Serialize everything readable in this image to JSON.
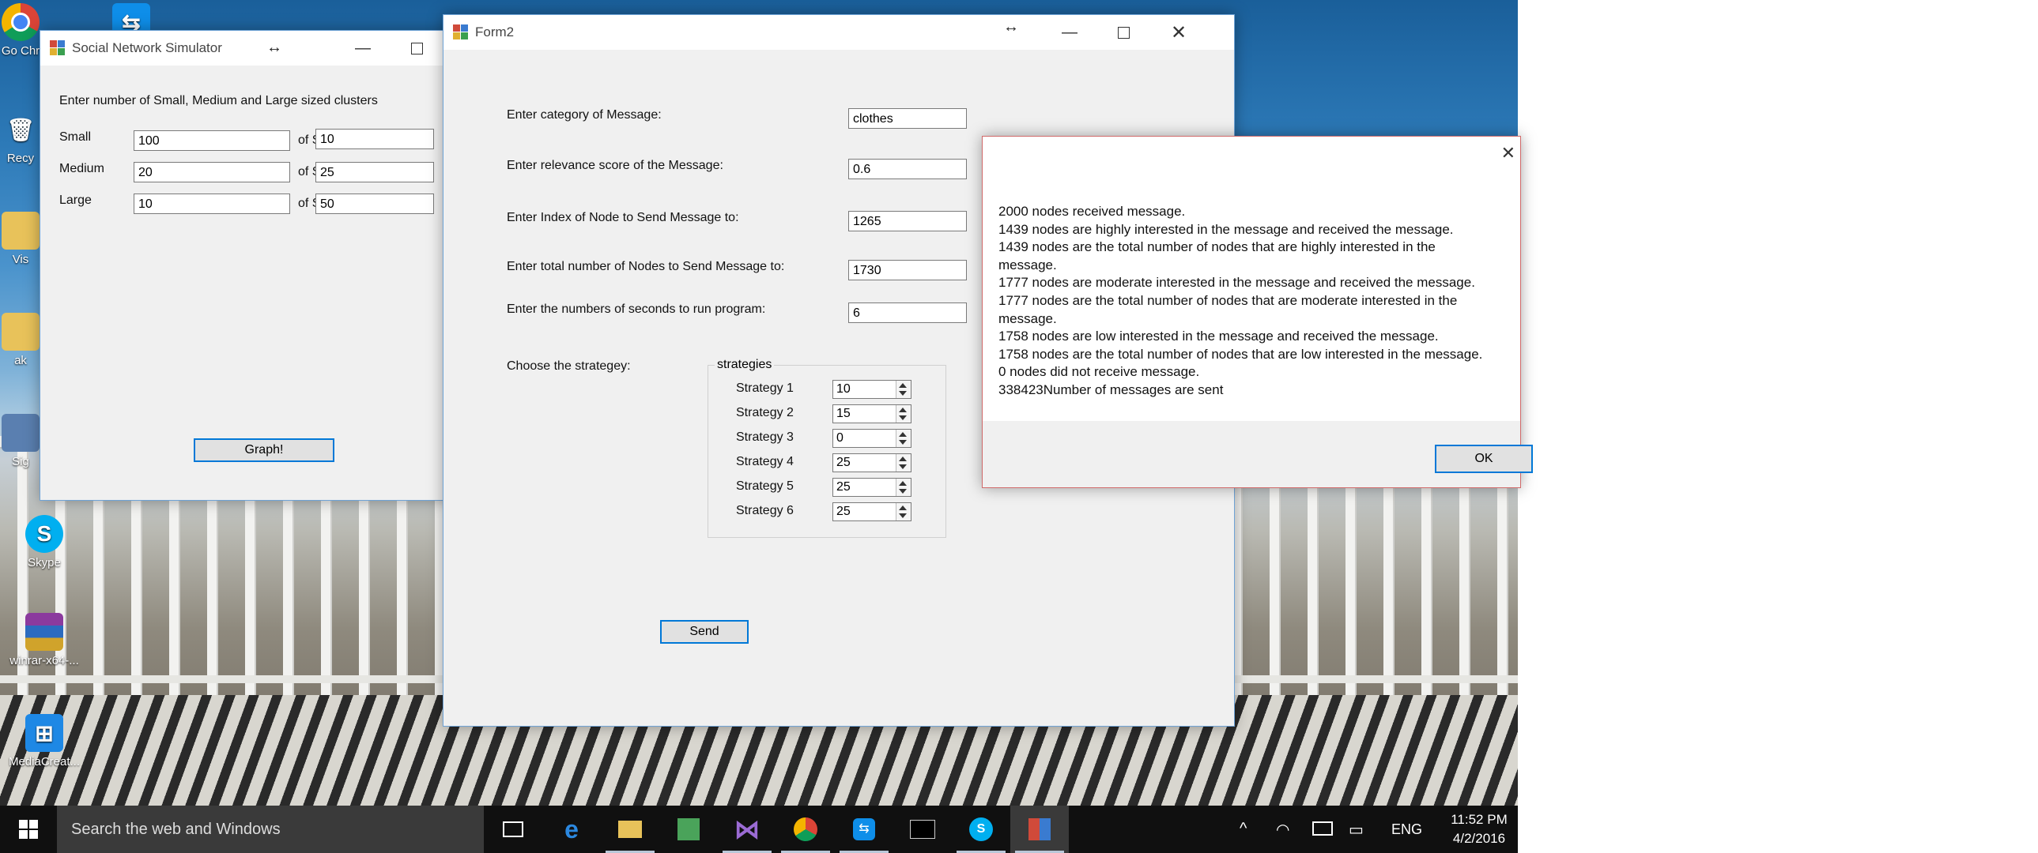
{
  "desktop_icons": [
    {
      "id": "chrome",
      "label": "Go Chr"
    },
    {
      "id": "recycle",
      "label": "Recy"
    },
    {
      "id": "vis",
      "label": "Vis"
    },
    {
      "id": "ak",
      "label": "ak"
    },
    {
      "id": "sig",
      "label": "Sig"
    },
    {
      "id": "skype",
      "label": "Skype"
    },
    {
      "id": "winrar",
      "label": "winrar-x64-..."
    },
    {
      "id": "mediacreation",
      "label": "MediaCreat..."
    }
  ],
  "sns_window": {
    "title": "Social Network Simulator",
    "instruction": "Enter number of Small, Medium and Large sized clusters",
    "rows": [
      {
        "label": "Small",
        "count": "100",
        "size_label": "of Size",
        "size": "10"
      },
      {
        "label": "Medium",
        "count": "20",
        "size_label": "of Size",
        "size": "25"
      },
      {
        "label": "Large",
        "count": "10",
        "size_label": "of Size",
        "size": "50"
      }
    ],
    "graph_button": "Graph!"
  },
  "form2": {
    "title": "Form2",
    "fields": [
      {
        "label": "Enter category of Message:",
        "value": "clothes"
      },
      {
        "label": "Enter relevance score of the Message:",
        "value": "0.6"
      },
      {
        "label": "Enter Index of Node to Send Message to:",
        "value": "1265"
      },
      {
        "label": "Enter total number of Nodes to Send Message to:",
        "value": "1730"
      },
      {
        "label": "Enter the numbers of seconds to run program:",
        "value": "6"
      }
    ],
    "strategy_label": "Choose the strategey:",
    "strategies_group": "strategies",
    "strategies": [
      {
        "label": "Strategy 1",
        "value": "10"
      },
      {
        "label": "Strategy 2",
        "value": "15"
      },
      {
        "label": "Strategy 3",
        "value": "0"
      },
      {
        "label": "Strategy 4",
        "value": "25"
      },
      {
        "label": "Strategy 5",
        "value": "25"
      },
      {
        "label": "Strategy 6",
        "value": "25"
      }
    ],
    "send_button": "Send"
  },
  "message_box": {
    "lines": [
      "2000 nodes received message.",
      "1439 nodes are highly interested in the message and received the message.",
      "1439 nodes are the total number of nodes that are highly interested in the",
      "message.",
      "1777 nodes are moderate interested in the message and received the message.",
      "1777 nodes are the total number of nodes that are moderate interested in the",
      "message.",
      "1758 nodes are low interested in the message and received the message.",
      "1758 nodes are the total number of nodes that are low interested in the message.",
      "0 nodes did not receive message.",
      "338423Number of messages are sent"
    ],
    "ok_button": "OK"
  },
  "taskbar": {
    "search_placeholder": "Search the web and Windows",
    "language": "ENG",
    "time": "11:52 PM",
    "date": "4/2/2016"
  },
  "colors": {
    "accent": "#0078d7",
    "taskbar": "#101010",
    "window_bg": "#f0f0f0"
  }
}
